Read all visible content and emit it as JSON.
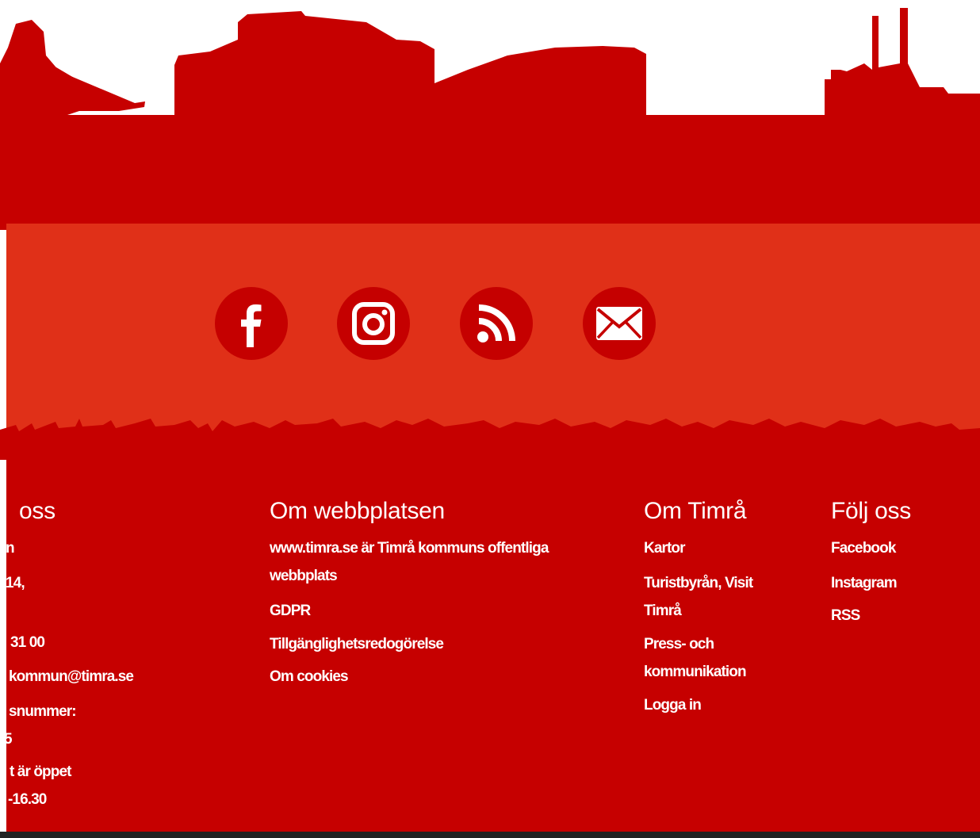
{
  "colors": {
    "skyline_red": "#c60000",
    "social_band": "#e03018",
    "footer_red": "#c60000",
    "icon_circle": "#c50000",
    "text": "#ffffff",
    "bottom_bar": "#222222"
  },
  "social_icons": [
    "facebook-icon",
    "instagram-icon",
    "rss-icon",
    "mail-icon"
  ],
  "columns": {
    "contact": {
      "title": "oss",
      "lines": [
        "n",
        "14,",
        "31 00",
        "kommun@timra.se",
        "snummer:",
        "5",
        "t är öppet",
        "-16.30"
      ]
    },
    "about_site": {
      "title": "Om webbplatsen",
      "description_line1": "www.timra.se är Timrå kommuns offentliga",
      "description_line2": "webbplats",
      "links": [
        "GDPR",
        "Tillgänglighetsredogörelse",
        "Om cookies"
      ]
    },
    "about_timra": {
      "title": "Om Timrå",
      "links": {
        "maps": "Kartor",
        "tourist_line1": "Turistbyrån, Visit",
        "tourist_line2": "Timrå",
        "press_line1": "Press- och",
        "press_line2": "kommunikation",
        "login": "Logga in"
      }
    },
    "follow": {
      "title": "Följ oss",
      "links": [
        "Facebook",
        "Instagram",
        "RSS"
      ]
    }
  }
}
